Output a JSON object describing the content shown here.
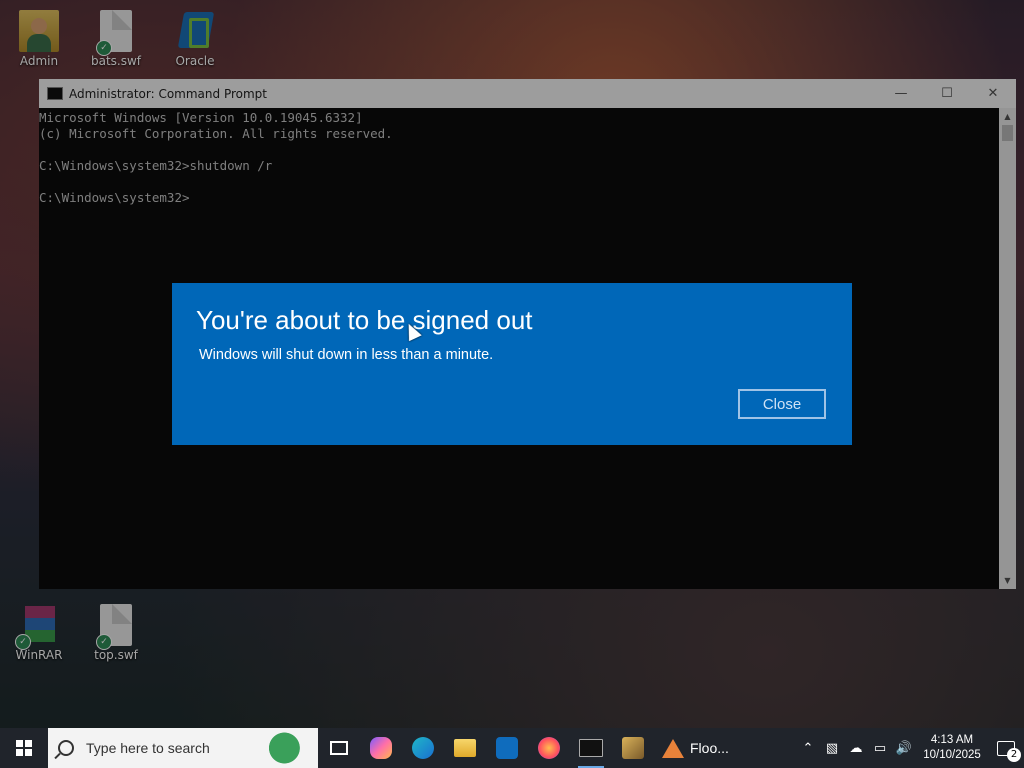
{
  "desktop": {
    "icons": [
      {
        "label": "Admin"
      },
      {
        "label": "bats.swf"
      },
      {
        "label": "Oracle"
      },
      {
        "label": "WinRAR"
      },
      {
        "label": "top.swf"
      }
    ]
  },
  "cmd_window": {
    "title": "Administrator: Command Prompt",
    "lines": [
      "Microsoft Windows [Version 10.0.19045.6332]",
      "(c) Microsoft Corporation. All rights reserved.",
      "",
      "C:\\Windows\\system32>shutdown /r",
      "",
      "C:\\Windows\\system32>"
    ]
  },
  "dialog": {
    "title": "You're about to be signed out",
    "message": "Windows will shut down in less than a minute.",
    "close_label": "Close"
  },
  "taskbar": {
    "search_placeholder": "Type here to search",
    "floo_label": "Floo...",
    "time": "4:13 AM",
    "date": "10/10/2025",
    "notification_count": "2"
  },
  "colors": {
    "dialog_bg": "#0067b8",
    "taskbar_bg": "#20242b",
    "console_bg": "#0c0c0c"
  }
}
